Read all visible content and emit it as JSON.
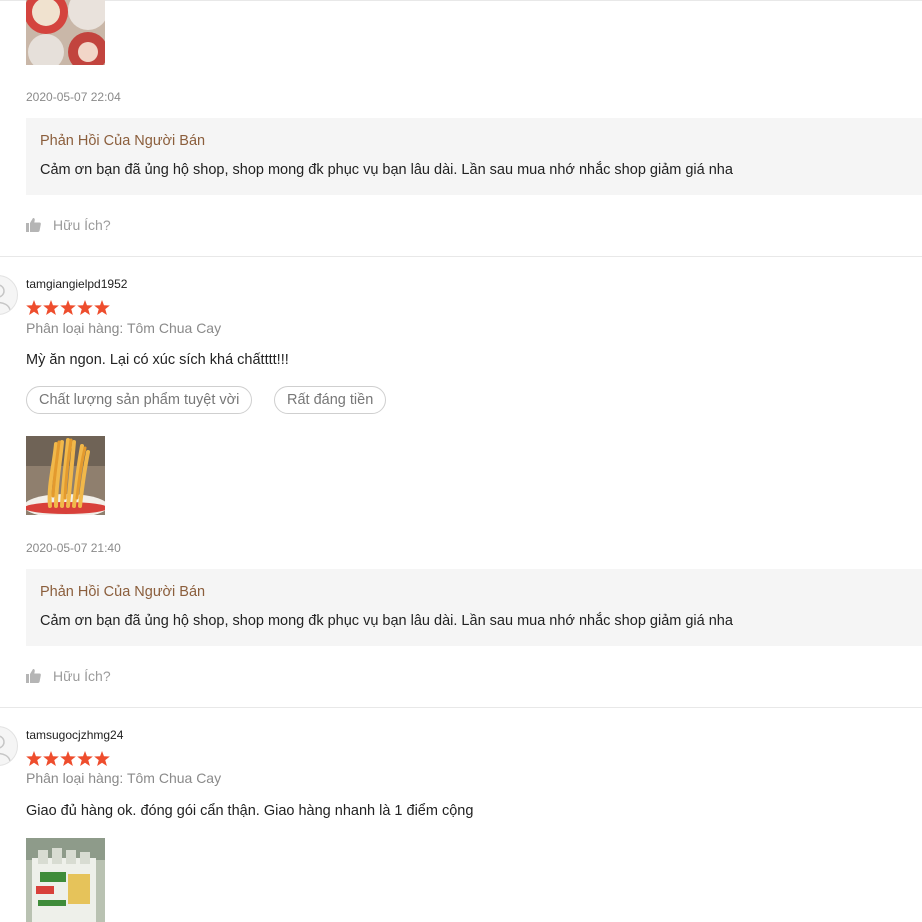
{
  "reviews": [
    {
      "date": "2020-05-07 22:04",
      "reply_title": "Phản Hồi Của Người Bán",
      "reply_text": "Cảm ơn bạn đã ủng hộ shop, shop mong đk phục vụ bạn lâu dài. Lần sau mua nhớ nhắc shop giảm giá nha",
      "helpful_label": "Hữu Ích?"
    },
    {
      "username": "tamgiangielpd1952",
      "rating": 5,
      "variant": "Phân loại hàng: Tôm Chua Cay",
      "comment": "Mỳ ăn ngon. Lại có xúc sích khá chấtttt!!!",
      "tags": [
        "Chất lượng sản phẩm tuyệt vời",
        "Rất đáng tiền"
      ],
      "date": "2020-05-07 21:40",
      "reply_title": "Phản Hồi Của Người Bán",
      "reply_text": "Cảm ơn bạn đã ủng hộ shop, shop mong đk phục vụ bạn lâu dài. Lần sau mua nhớ nhắc shop giảm giá nha",
      "helpful_label": "Hữu Ích?"
    },
    {
      "username": "tamsugocjzhmg24",
      "rating": 5,
      "variant": "Phân loại hàng: Tôm Chua Cay",
      "comment": "Giao đủ hàng ok. đóng gói cẩn thận. Giao hàng nhanh là 1 điểm cộng"
    }
  ],
  "colors": {
    "star": "#ee4d2d",
    "reply_title": "#8b5e3c",
    "reply_bg": "#f5f5f5",
    "muted": "#8a8a8a"
  },
  "icons": {
    "helpful": "thumbs-up-icon",
    "avatar": "user-avatar-icon",
    "star": "star-icon"
  }
}
